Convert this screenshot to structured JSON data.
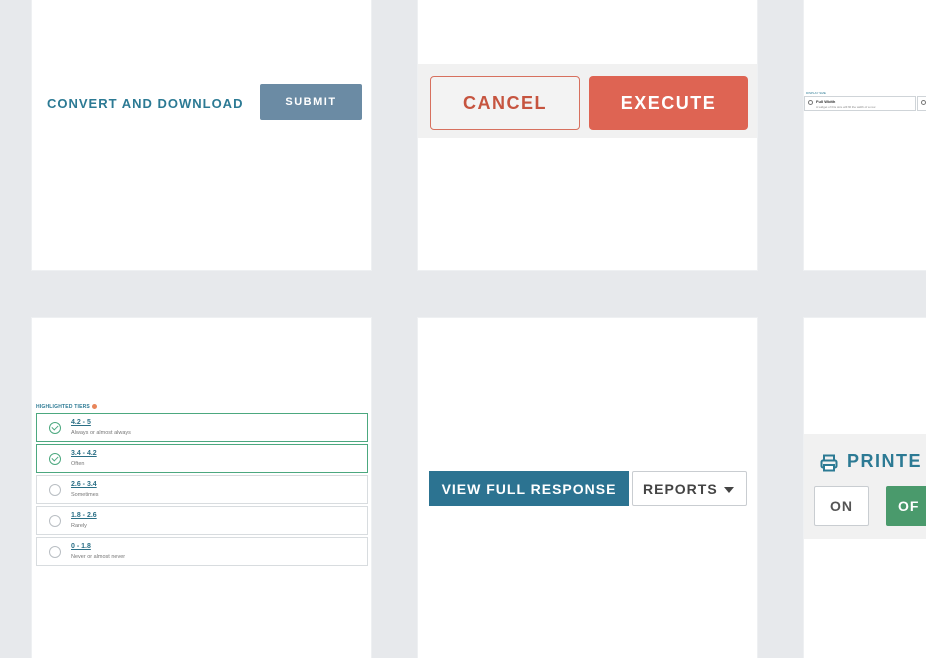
{
  "card_convert": {
    "link_label": "CONVERT AND DOWNLOAD",
    "submit_label": "SUBMIT"
  },
  "card_actions": {
    "cancel_label": "CANCEL",
    "execute_label": "EXECUTE"
  },
  "card_width_selector": {
    "heading": "DISPLAY SIZE",
    "options": [
      {
        "title": "Full Width",
        "description": "A widget of this size will fill the width of a row"
      }
    ]
  },
  "card_tiers": {
    "heading": "HIGHLIGHTED TIERS",
    "tiers": [
      {
        "range": "4.2 - 5",
        "description": "Always or almost always",
        "selected": true
      },
      {
        "range": "3.4 - 4.2",
        "description": "Often",
        "selected": true
      },
      {
        "range": "2.6 - 3.4",
        "description": "Sometimes",
        "selected": false
      },
      {
        "range": "1.8 - 2.6",
        "description": "Rarely",
        "selected": false
      },
      {
        "range": "0 - 1.8",
        "description": "Never or almost never",
        "selected": false
      }
    ]
  },
  "card_response": {
    "view_label": "VIEW FULL RESPONSE",
    "reports_label": "REPORTS"
  },
  "card_printer": {
    "title": "PRINTE",
    "on_label": "ON",
    "off_label": "OF"
  },
  "colors": {
    "background": "#e7e9ec",
    "teal_link": "#2c7a94",
    "submit": "#6b8ba4",
    "execute": "#de6453",
    "cancel_text": "#c6543f",
    "view_button": "#2c7391",
    "selected_tier": "#4ca87f",
    "off_button": "#4a9a6c"
  }
}
